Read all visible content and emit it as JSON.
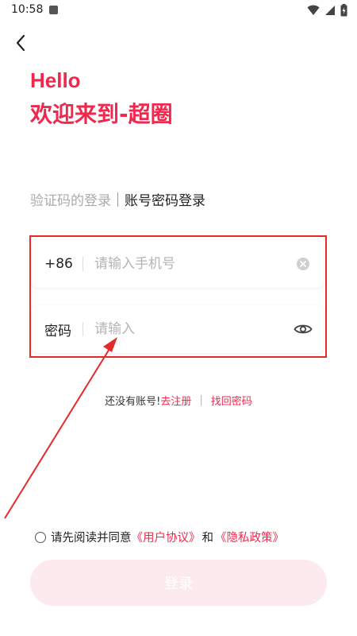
{
  "status_bar": {
    "time": "10:58"
  },
  "header": {
    "greeting": "Hello",
    "welcome": "欢迎来到-超圈"
  },
  "tabs": {
    "sms_login": "验证码的登录",
    "account_login": "账号密码登录"
  },
  "phone_field": {
    "prefix": "+86",
    "placeholder": "请输入手机号",
    "value": ""
  },
  "password_field": {
    "label": "密码",
    "placeholder": "请输入",
    "value": ""
  },
  "signup": {
    "prompt": "还没有账号!",
    "signup_link": "去注册",
    "separator": "|",
    "forgot_link": "找回密码"
  },
  "agreement": {
    "prefix": "请先阅读并同意",
    "user_agreement": "《用户协议》",
    "and": "和",
    "privacy_policy": "《隐私政策》"
  },
  "login_button": {
    "label": "登录"
  },
  "colors": {
    "accent": "#f0284e",
    "annotation": "#e52a2a",
    "button_disabled_bg": "#fdeaee"
  }
}
